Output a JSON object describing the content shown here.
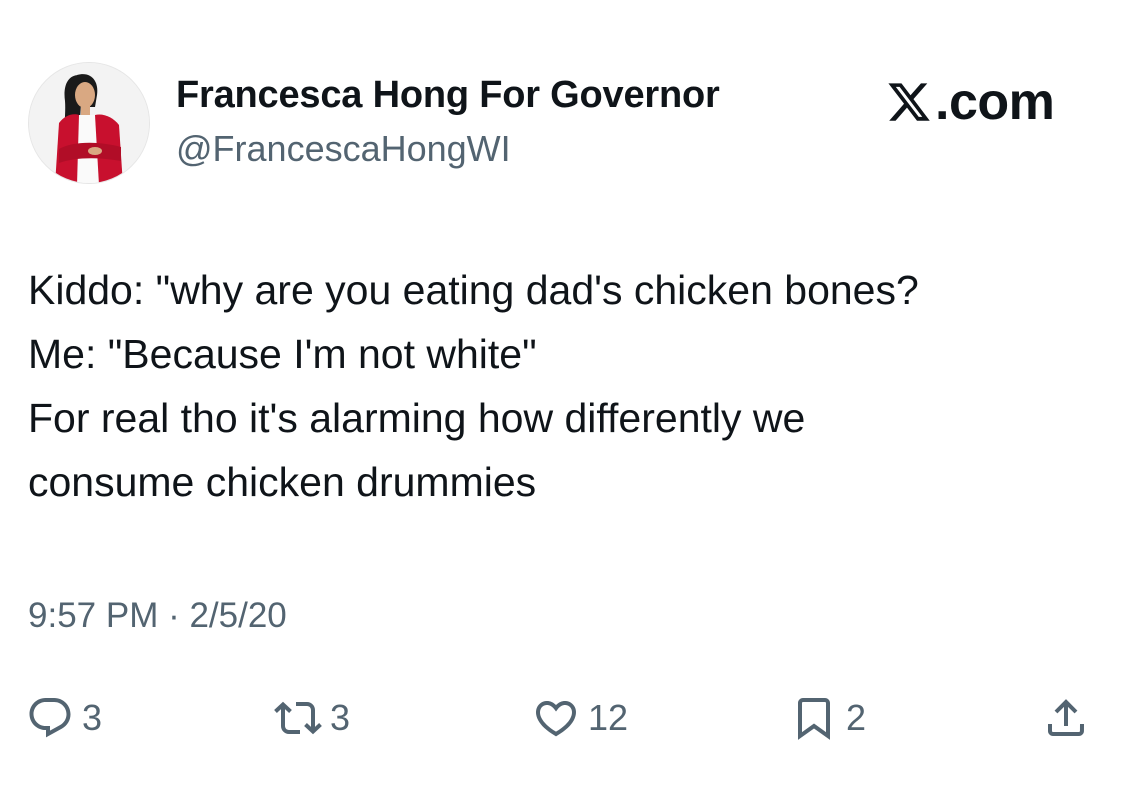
{
  "author": {
    "display_name": "Francesca Hong For Governor",
    "handle": "@FrancescaHongWI",
    "avatar_icon": "profile-photo-avatar"
  },
  "watermark": {
    "text": ".com",
    "icon": "x-logo-icon"
  },
  "tweet": {
    "lines": [
      "Kiddo: \"why are you eating dad's chicken bones?",
      "Me: \"Because I'm not white\"",
      "For real tho it's alarming how differently we",
      "consume chicken drummies"
    ],
    "timestamp": "9:57 PM · 2/5/20"
  },
  "actions": {
    "replies": {
      "count": "3",
      "icon": "reply-icon"
    },
    "reposts": {
      "count": "3",
      "icon": "repost-icon"
    },
    "likes": {
      "count": "12",
      "icon": "heart-icon"
    },
    "bookmarks": {
      "count": "2",
      "icon": "bookmark-icon"
    },
    "share": {
      "icon": "share-icon"
    }
  },
  "colors": {
    "text": "#0f1419",
    "secondary": "#536471",
    "avatar_jacket": "#c8102e"
  }
}
